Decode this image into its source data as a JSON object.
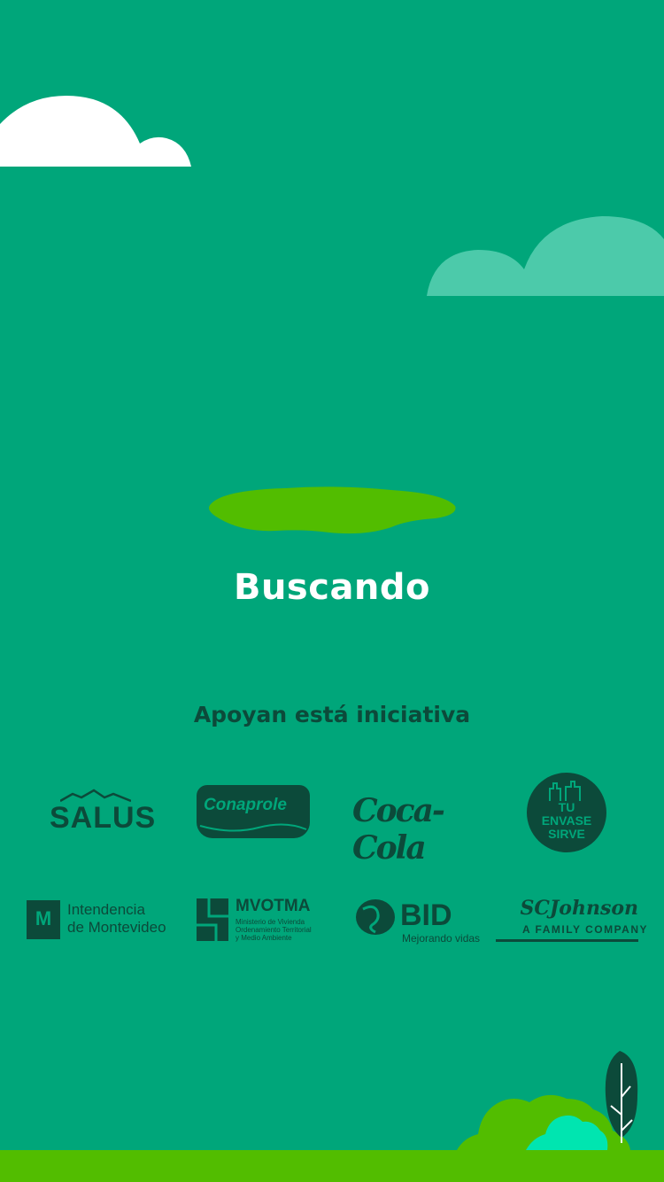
{
  "screen": {
    "status_title": "Buscando",
    "supporters_heading": "Apoyan está iniciativa"
  },
  "colors": {
    "background": "#00a67a",
    "cloud_white": "#ffffff",
    "cloud_teal": "#4ccaaa",
    "blob": "#52bd00",
    "logo_dark": "#0c4a3a",
    "ground": "#52bd00",
    "bush_light": "#00e5b0"
  },
  "supporters": {
    "salus": "SALUS",
    "conaprole": "Conaprole",
    "cocacola": "Coca-Cola",
    "tuenvase": [
      "TU",
      "ENVASE",
      "SIRVE"
    ],
    "intendencia": [
      "Intendencia",
      "de Montevideo"
    ],
    "mvotma": {
      "name": "MVOTMA",
      "sub": [
        "Ministerio de Vivienda",
        "Ordenamiento Territorial",
        "y Medio Ambiente"
      ]
    },
    "bid": {
      "name": "BID",
      "sub": "Mejorando vidas"
    },
    "scjohnson": {
      "name": "SCJohnson",
      "sub": "A FAMILY COMPANY"
    }
  }
}
